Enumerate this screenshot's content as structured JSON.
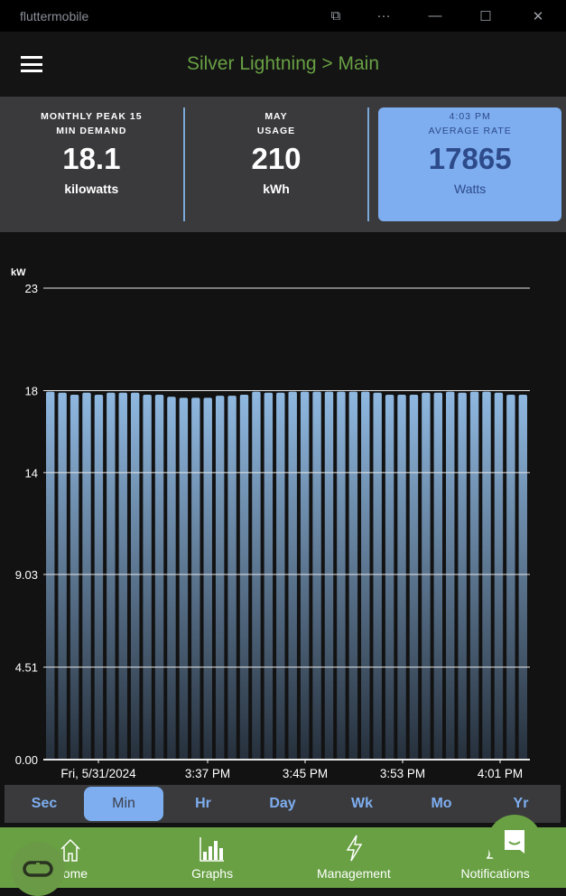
{
  "window": {
    "title": "fluttermobile"
  },
  "appbar": {
    "title": "Silver Lightning > Main"
  },
  "stats": [
    {
      "label_line1": "MONTHLY PEAK 15",
      "label_line2": "MIN DEMAND",
      "value": "18.1",
      "unit": "kilowatts"
    },
    {
      "label_line1": "MAY",
      "label_line2": "USAGE",
      "value": "210",
      "unit": "kWh"
    },
    {
      "label_line1": "4:03 PM",
      "label_line2": "AVERAGE RATE",
      "value": "17865",
      "unit": "Watts",
      "highlighted": true
    }
  ],
  "chart_data": {
    "type": "bar",
    "ylabel": "kW",
    "yticks": [
      "0.00",
      "4.51",
      "9.03",
      "14",
      "18",
      "23"
    ],
    "ylim": [
      0,
      23
    ],
    "xtick_labels": [
      "Fri, 5/31/2024",
      "3:37 PM",
      "3:45 PM",
      "3:53 PM",
      "4:01 PM"
    ],
    "values": [
      17.95,
      17.9,
      17.8,
      17.9,
      17.8,
      17.9,
      17.9,
      17.9,
      17.8,
      17.8,
      17.7,
      17.65,
      17.65,
      17.65,
      17.75,
      17.75,
      17.8,
      17.95,
      17.9,
      17.9,
      17.95,
      17.95,
      17.95,
      17.95,
      17.95,
      17.95,
      17.95,
      17.9,
      17.8,
      17.8,
      17.8,
      17.9,
      17.9,
      17.95,
      17.9,
      17.95,
      17.95,
      17.9,
      17.8,
      17.8
    ],
    "bar_color_top": "#8fb8e0",
    "bar_color_bottom": "#26303c",
    "grid": true
  },
  "ranges": [
    {
      "label": "Sec"
    },
    {
      "label": "Min",
      "selected": true
    },
    {
      "label": "Hr"
    },
    {
      "label": "Day"
    },
    {
      "label": "Wk"
    },
    {
      "label": "Mo"
    },
    {
      "label": "Yr"
    }
  ],
  "nav": [
    {
      "label": "Home"
    },
    {
      "label": "Graphs"
    },
    {
      "label": "Management"
    },
    {
      "label": "Notifications"
    }
  ],
  "colors": {
    "accent": "#68a043",
    "highlight": "#7eaef0"
  }
}
